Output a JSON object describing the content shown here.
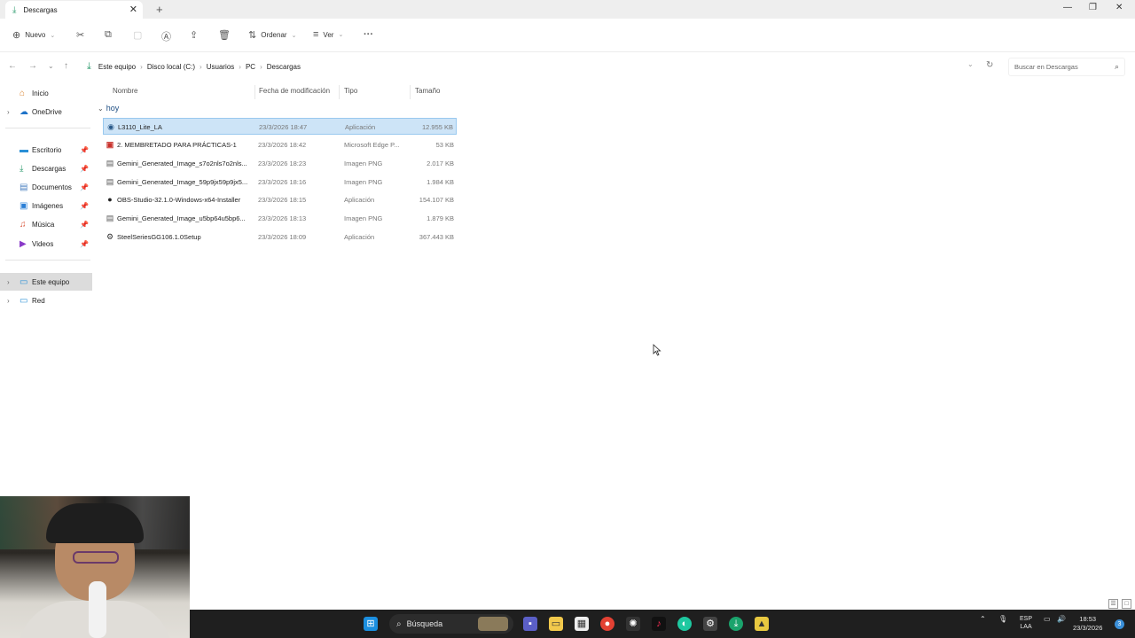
{
  "window": {
    "tab_title": "Descargas",
    "tab_close": "✕",
    "new_tab": "+",
    "minimize": "—",
    "maximize": "❐",
    "close": "✕"
  },
  "toolbar": {
    "new_label": "Nuevo",
    "sort_label": "Ordenar",
    "view_label": "Ver",
    "more_label": "···"
  },
  "address": {
    "crumbs": [
      "Este equipo",
      "Disco local (C:)",
      "Usuarios",
      "PC",
      "Descargas"
    ],
    "search_placeholder": "Buscar en Descargas"
  },
  "sidebar": {
    "items": [
      {
        "label": "Inicio",
        "icon": "home-icon"
      },
      {
        "label": "OneDrive",
        "icon": "cloud-icon"
      },
      {
        "label": "Escritorio",
        "icon": "desktop-icon"
      },
      {
        "label": "Descargas",
        "icon": "download-icon"
      },
      {
        "label": "Documentos",
        "icon": "document-icon"
      },
      {
        "label": "Imágenes",
        "icon": "image-icon"
      },
      {
        "label": "Música",
        "icon": "music-icon"
      },
      {
        "label": "Videos",
        "icon": "video-icon"
      },
      {
        "label": "Este equipo",
        "icon": "computer-icon"
      },
      {
        "label": "Red",
        "icon": "network-icon"
      }
    ]
  },
  "columns": {
    "name": "Nombre",
    "modified": "Fecha de modificación",
    "type": "Tipo",
    "size": "Tamaño"
  },
  "group": {
    "label": "hoy"
  },
  "files": [
    {
      "name": "L3110_Lite_LA",
      "date": "23/3/2026 18:47",
      "type": "Aplicación",
      "size": "12.955 KB"
    },
    {
      "name": "2. MEMBRETADO PARA PRÁCTICAS-1",
      "date": "23/3/2026 18:42",
      "type": "Microsoft Edge P...",
      "size": "53 KB"
    },
    {
      "name": "Gemini_Generated_Image_s7o2nls7o2nls...",
      "date": "23/3/2026 18:23",
      "type": "Imagen PNG",
      "size": "2.017 KB"
    },
    {
      "name": "Gemini_Generated_Image_59p9jx59p9jx5...",
      "date": "23/3/2026 18:16",
      "type": "Imagen PNG",
      "size": "1.984 KB"
    },
    {
      "name": "OBS-Studio-32.1.0-Windows-x64-Installer",
      "date": "23/3/2026 18:15",
      "type": "Aplicación",
      "size": "154.107 KB"
    },
    {
      "name": "Gemini_Generated_Image_u5bp64u5bp6...",
      "date": "23/3/2026 18:13",
      "type": "Imagen PNG",
      "size": "1.879 KB"
    },
    {
      "name": "SteelSeriesGG106.1.0Setup",
      "date": "23/3/2026 18:09",
      "type": "Aplicación",
      "size": "367.443 KB"
    }
  ],
  "taskbar": {
    "search_label": "Búsqueda",
    "lang_line1": "ESP",
    "lang_line2": "LAA",
    "time": "18:53",
    "date": "23/3/2026",
    "notification_count": "3"
  }
}
